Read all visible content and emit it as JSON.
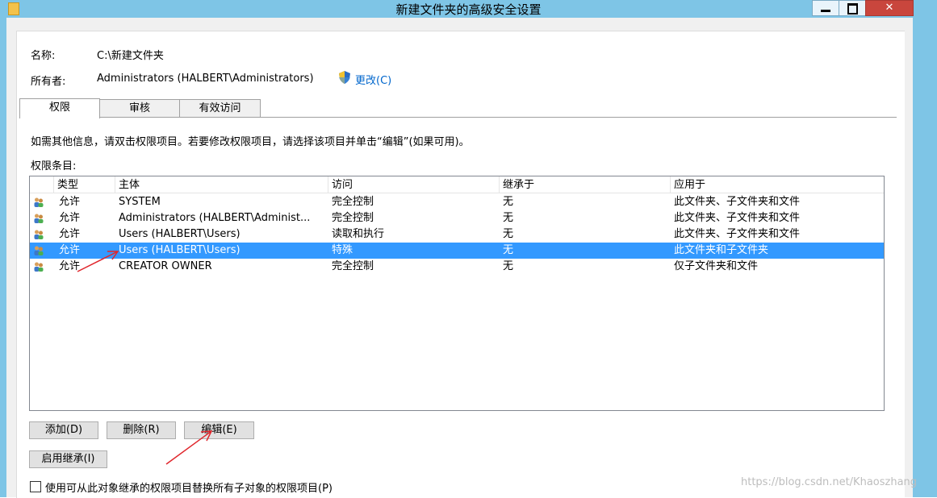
{
  "window": {
    "title": "新建文件夹的高级安全设置",
    "close_glyph": "✕",
    "colors": {
      "titlebar": "#7ec5e6",
      "close": "#c9463d",
      "selection": "#3399ff",
      "link": "#0066cc",
      "arrow": "#e0262c"
    }
  },
  "info": {
    "name_label": "名称:",
    "name_value": "C:\\新建文件夹",
    "owner_label": "所有者:",
    "owner_value": "Administrators (HALBERT\\Administrators)",
    "change_link": "更改(C)"
  },
  "tabs": [
    {
      "label": "权限",
      "active": true
    },
    {
      "label": "审核",
      "active": false
    },
    {
      "label": "有效访问",
      "active": false
    }
  ],
  "hint": "如需其他信息，请双击权限项目。若要修改权限项目，请选择该项目并单击“编辑”(如果可用)。",
  "entries_label": "权限条目:",
  "table": {
    "headers": [
      "类型",
      "主体",
      "访问",
      "继承于",
      "应用于"
    ],
    "rows": [
      {
        "type": "允许",
        "principal": "SYSTEM",
        "access": "完全控制",
        "inherited": "无",
        "applies": "此文件夹、子文件夹和文件",
        "selected": false
      },
      {
        "type": "允许",
        "principal": "Administrators (HALBERT\\Administ...",
        "access": "完全控制",
        "inherited": "无",
        "applies": "此文件夹、子文件夹和文件",
        "selected": false
      },
      {
        "type": "允许",
        "principal": "Users (HALBERT\\Users)",
        "access": "读取和执行",
        "inherited": "无",
        "applies": "此文件夹、子文件夹和文件",
        "selected": false
      },
      {
        "type": "允许",
        "principal": "Users (HALBERT\\Users)",
        "access": "特殊",
        "inherited": "无",
        "applies": "此文件夹和子文件夹",
        "selected": true
      },
      {
        "type": "允许",
        "principal": "CREATOR OWNER",
        "access": "完全控制",
        "inherited": "无",
        "applies": "仅子文件夹和文件",
        "selected": false
      }
    ]
  },
  "buttons": {
    "add": "添加(D)",
    "remove": "删除(R)",
    "edit": "编辑(E)",
    "enable_inheritance": "启用继承(I)"
  },
  "replace_checkbox": {
    "label": "使用可从此对象继承的权限项目替换所有子对象的权限项目(P)",
    "checked": false
  },
  "watermark": "https://blog.csdn.net/Khaoszhang"
}
